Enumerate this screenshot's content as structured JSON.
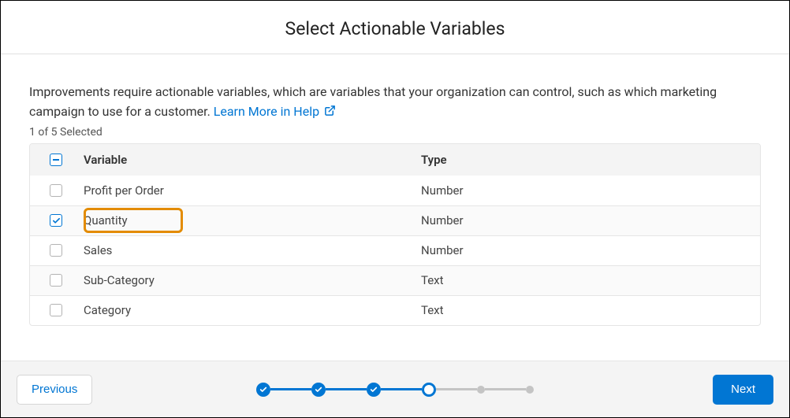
{
  "header": {
    "title": "Select Actionable Variables"
  },
  "description": {
    "text": "Improvements require actionable variables, which are variables that your organization can control, such as which marketing campaign to use for a customer.",
    "link_text": "Learn More in Help"
  },
  "selection_count": "1 of 5 Selected",
  "table": {
    "headers": {
      "variable": "Variable",
      "type": "Type"
    },
    "rows": [
      {
        "variable": "Profit per Order",
        "type": "Number",
        "checked": false,
        "highlighted": false
      },
      {
        "variable": "Quantity",
        "type": "Number",
        "checked": true,
        "highlighted": true
      },
      {
        "variable": "Sales",
        "type": "Number",
        "checked": false,
        "highlighted": false
      },
      {
        "variable": "Sub-Category",
        "type": "Text",
        "checked": false,
        "highlighted": false
      },
      {
        "variable": "Category",
        "type": "Text",
        "checked": false,
        "highlighted": false
      }
    ]
  },
  "footer": {
    "previous": "Previous",
    "next": "Next",
    "steps": [
      "done",
      "done",
      "done",
      "current",
      "future",
      "future"
    ]
  }
}
